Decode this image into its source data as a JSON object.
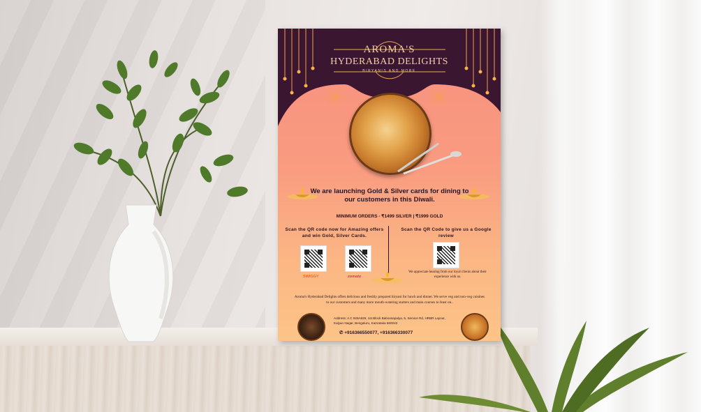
{
  "poster": {
    "brand_line1": "AROMA'S",
    "brand_line2": "HYDERABAD DELIGHTS",
    "brand_tagline": "BIRYANIS AND MORE",
    "headline": "We are launching Gold & Silver cards for dining to our customers in this Diwali.",
    "minimum_orders": "MINIMUM ORDERS - ₹1499 SILVER |  ₹1999 GOLD",
    "left_scan_text": "Scan the QR code now for Amazing offers and win Gold, Silver Cards.",
    "right_scan_text": "Scan the QR Code to give us a Google review",
    "review_note": "We appreciate hearing from our loyal clients about their experience with us.",
    "swiggy_label": "SWIGGY",
    "zomato_label": "zomato",
    "about_text": "Aroma's Hyderabad Delights offers delicious and freshly prepared biryani for lunch and dinner. We serve veg and non-veg cuisines to our customers and many more mouth-watering starters and main courses to feast on..",
    "address": "Address: A C 928A929, 1st Block Baboosapalya, 5, Service Rd, HRBR Layout, Kalyan Nagar, Bengaluru, Karnataka 560043",
    "phone": "+916366550077, +916366330077"
  },
  "colors": {
    "poster_top": "#3b1630",
    "poster_peach": "#f99c80",
    "gold_text": "#f3cfa0",
    "swiggy": "#f26b21",
    "zomato": "#e23744"
  }
}
